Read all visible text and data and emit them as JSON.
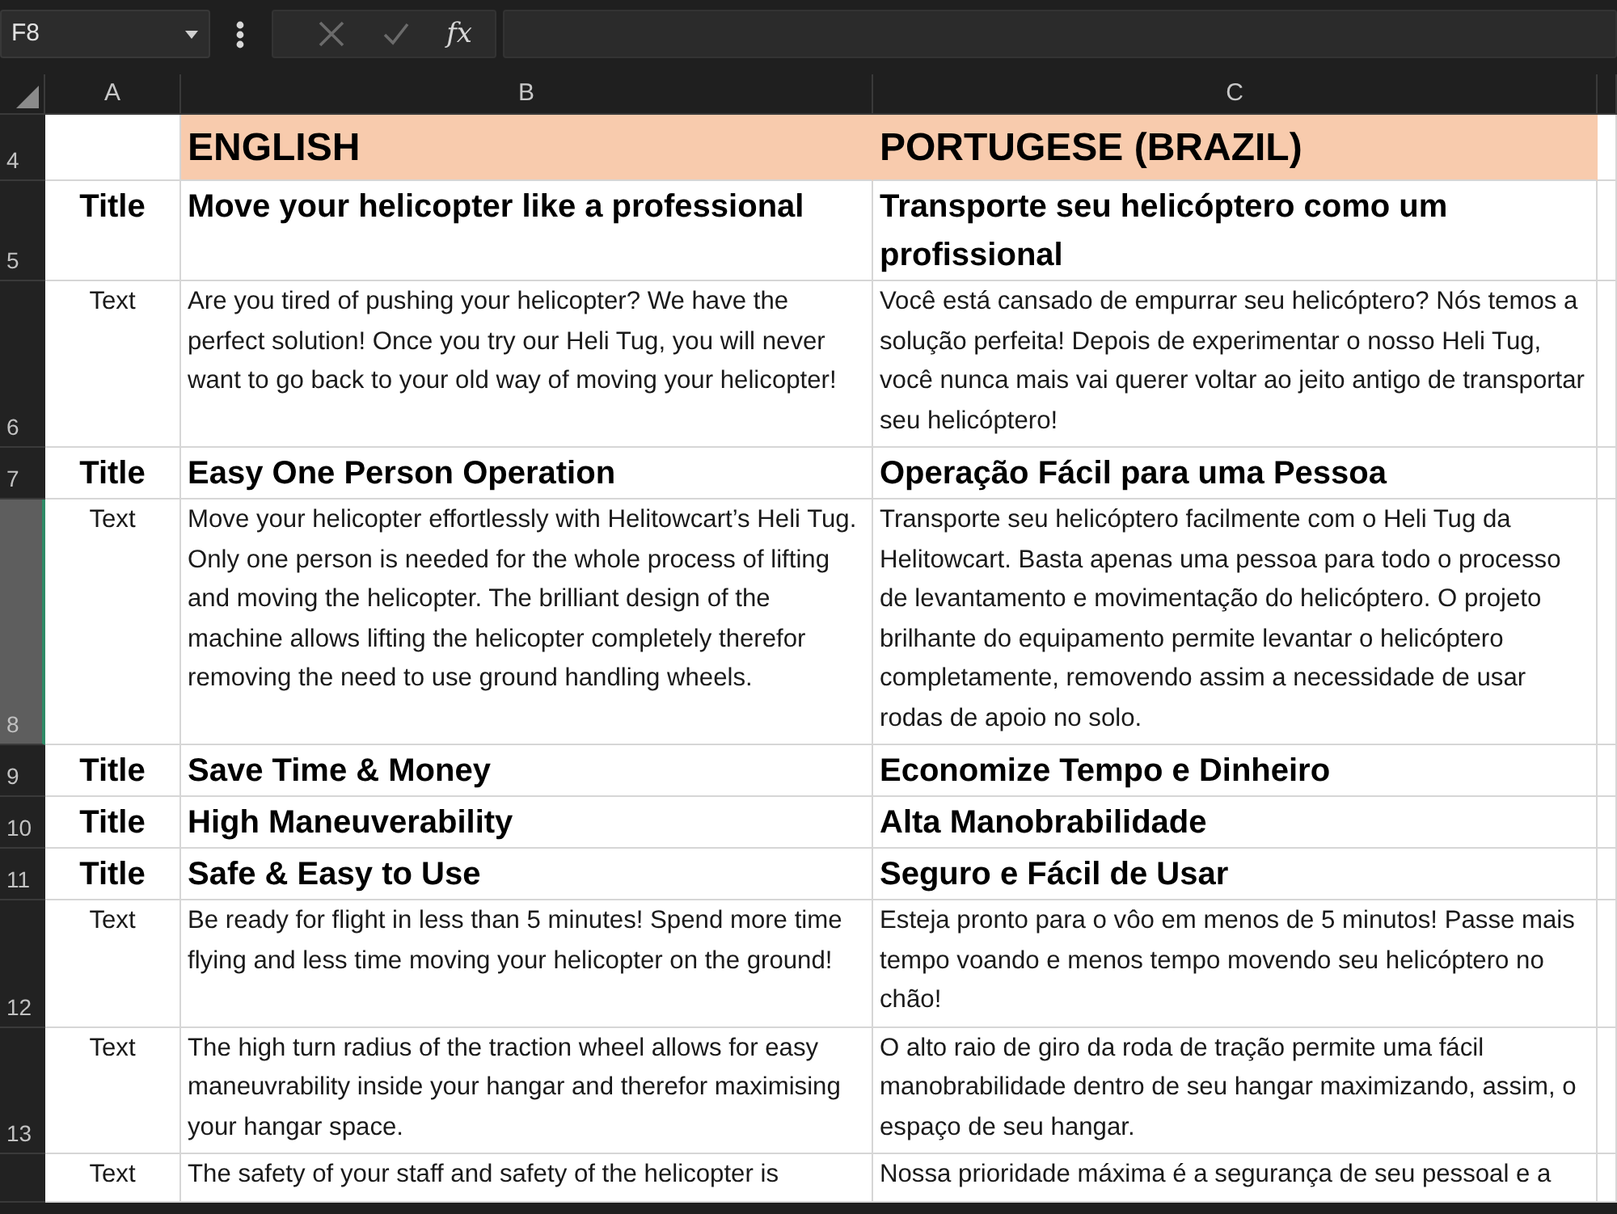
{
  "formula_bar": {
    "name_box": "F8",
    "function_label": "fx"
  },
  "columns": [
    {
      "label": "A"
    },
    {
      "label": "B"
    },
    {
      "label": "C"
    }
  ],
  "rows": [
    {
      "number": "4",
      "selected": false,
      "kind": "header",
      "cells": [
        "ENGLISH",
        "PORTUGESE (BRAZIL)"
      ]
    },
    {
      "number": "5",
      "selected": false,
      "kind": "title",
      "label": "Title",
      "cells": [
        "Move your helicopter like a professional",
        "Transporte seu helicóptero como um profissional"
      ]
    },
    {
      "number": "6",
      "selected": false,
      "kind": "text",
      "label": "Text",
      "cells": [
        "Are you tired of pushing your helicopter? We have the perfect solution! Once you try our Heli Tug, you will never want to go back to your old way of moving your helicopter!",
        "Você está cansado de empurrar seu helicóptero? Nós temos a solução perfeita! Depois de experimentar o nosso Heli Tug, você nunca mais vai querer voltar ao jeito antigo de transportar seu helicóptero!"
      ]
    },
    {
      "number": "7",
      "selected": false,
      "kind": "title",
      "label": "Title",
      "cells": [
        "Easy One Person Operation",
        "Operação Fácil para uma Pessoa"
      ]
    },
    {
      "number": "8",
      "selected": true,
      "kind": "text",
      "label": "Text",
      "cells": [
        "Move your helicopter effortlessly with Helitowcart’s Heli Tug. Only one person is needed for the whole process of lifting and moving the helicopter. The brilliant design of the machine allows lifting the helicopter completely therefor removing the need to use ground handling wheels.",
        "Transporte seu helicóptero facilmente com o Heli Tug da Helitowcart. Basta apenas uma pessoa para todo o processo de levantamento e movimentação do helicóptero. O projeto brilhante do equipamento permite levantar o helicóptero completamente, removendo assim a necessidade de usar rodas de apoio no solo."
      ]
    },
    {
      "number": "9",
      "selected": false,
      "kind": "title",
      "label": "Title",
      "cells": [
        "Save Time & Money",
        "Economize Tempo e Dinheiro"
      ]
    },
    {
      "number": "10",
      "selected": false,
      "kind": "title",
      "label": "Title",
      "cells": [
        "High Maneuverability",
        "Alta Manobrabilidade"
      ]
    },
    {
      "number": "11",
      "selected": false,
      "kind": "title",
      "label": "Title",
      "cells": [
        "Safe & Easy to Use",
        "Seguro e Fácil de Usar"
      ]
    },
    {
      "number": "12",
      "selected": false,
      "kind": "text",
      "label": "Text",
      "cells": [
        "Be ready for flight in less than 5 minutes! Spend more time flying and less time moving your helicopter on the ground!",
        "Esteja pronto para o vôo em menos de 5 minutos! Passe mais tempo voando e menos tempo movendo seu helicóptero no chão!"
      ]
    },
    {
      "number": "13",
      "selected": false,
      "kind": "text",
      "label": "Text",
      "cells": [
        "The high turn radius of the traction wheel allows for easy maneuvrability inside your hangar and therefor maximising your hangar space.",
        "O alto raio de giro da roda de tração permite uma fácil manobrabilidade dentro de seu hangar maximizando, assim, o espaço de seu hangar."
      ]
    },
    {
      "selected": false,
      "kind": "text",
      "label": "Text",
      "cells": [
        "The safety of your staff and safety of the helicopter is",
        "Nossa prioridade máxima é a segurança de seu pessoal e a"
      ]
    }
  ]
}
